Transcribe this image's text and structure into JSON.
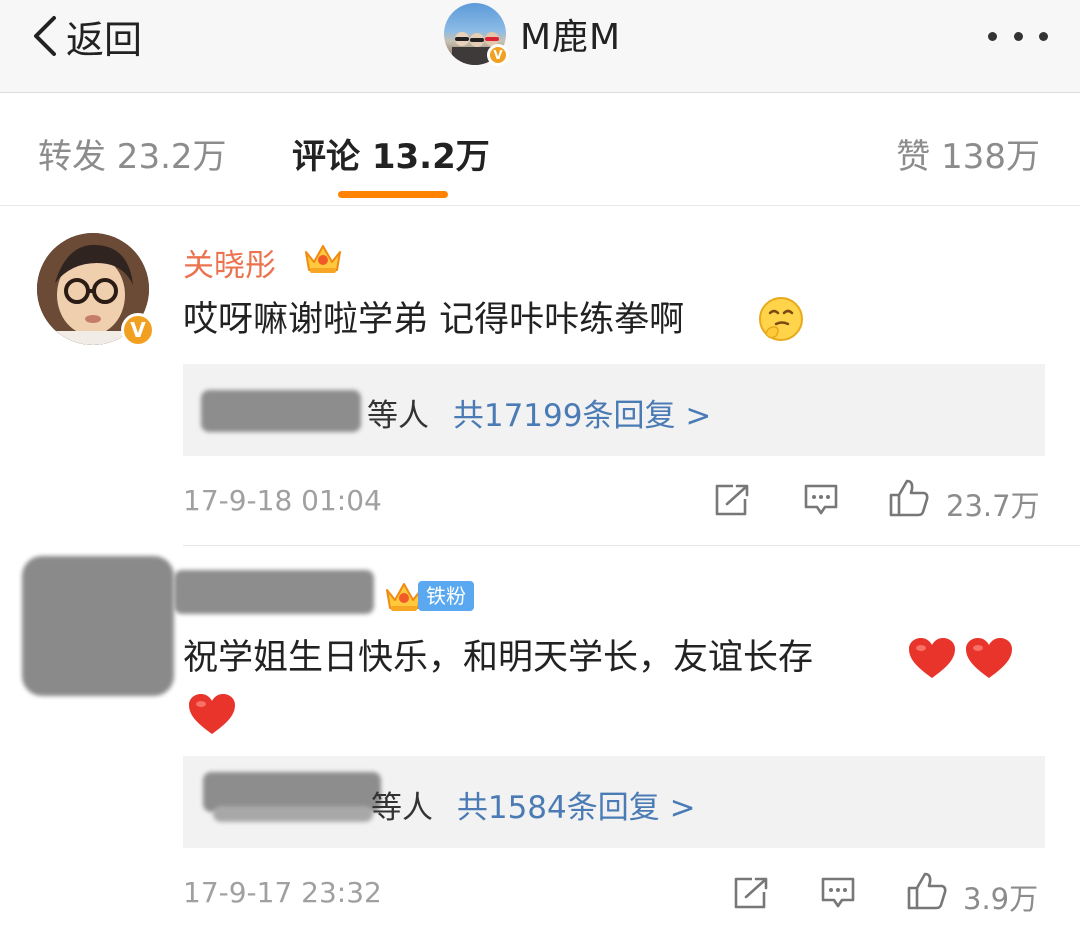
{
  "nav": {
    "back_label": "返回",
    "username": "M鹿M",
    "verified_mark": "V",
    "icons": [
      "chevron-left-icon",
      "more-dots-icon"
    ]
  },
  "tabs": {
    "repost": "转发 23.2万",
    "comment": "评论 13.2万",
    "like": "赞 138万",
    "indicator_color": "#ff8200"
  },
  "comments": [
    {
      "author": "关晓彤",
      "verified_mark": "V",
      "text": "哎呀嘛谢啦学弟 记得咔咔练拳啊",
      "emoji": "thinking-face-icon",
      "replies_suffix": "等人",
      "replies_link": "共17199条回复 >",
      "time": "17-9-18 01:04",
      "likes": "23.7万"
    },
    {
      "author": "",
      "fan_badge": "铁粉",
      "text_line1": "祝学姐生日快乐，和明天学长，友谊长存",
      "emoji": "heart-icon",
      "replies_suffix": "等人",
      "replies_link": "共1584条回复 >",
      "time": "17-9-17 23:32",
      "likes": "3.9万"
    }
  ],
  "colors": {
    "name_orange": "#eb7350",
    "link_blue": "#4a7bb5",
    "badge_blue": "#5aa9f0",
    "verified_gold": "#f2a020"
  }
}
